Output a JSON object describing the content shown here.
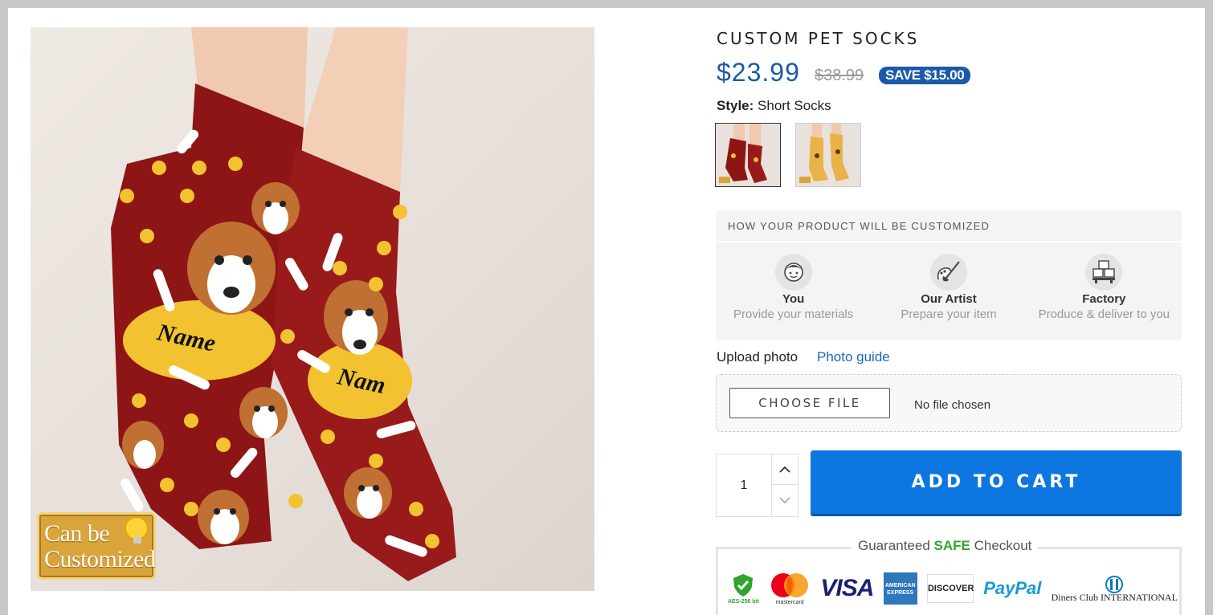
{
  "product": {
    "title": "CUSTOM PET SOCKS",
    "price": "$23.99",
    "old_price": "$38.99",
    "save_badge": "SAVE $15.00",
    "badge_text": "Can be Customized"
  },
  "style": {
    "label": "Style:",
    "value": "Short Socks",
    "swatches": [
      "short-socks-red",
      "long-socks-yellow"
    ]
  },
  "customization": {
    "heading": "HOW YOUR PRODUCT WILL BE CUSTOMIZED",
    "steps": [
      {
        "icon": "user-icon",
        "name": "You",
        "desc": "Provide your materials"
      },
      {
        "icon": "brush-icon",
        "name": "Our Artist",
        "desc": "Prepare your item"
      },
      {
        "icon": "boxes-icon",
        "name": "Factory",
        "desc": "Produce & deliver to you"
      }
    ]
  },
  "upload": {
    "label": "Upload photo",
    "guide_link": "Photo guide",
    "button": "CHOOSE FILE",
    "status": "No file chosen"
  },
  "cart": {
    "quantity": "1",
    "button": "ADD TO CART"
  },
  "checkout": {
    "title_prefix": "Guaranteed ",
    "title_safe": "SAFE",
    "title_suffix": " Checkout",
    "methods": [
      "AES-256 bit",
      "mastercard",
      "VISA",
      "AMERICAN EXPRESS",
      "DISCOVER",
      "PayPal",
      "Diners Club INTERNATIONAL"
    ]
  },
  "colors": {
    "accent": "#1a5aa8",
    "cart_button": "#0d76e0",
    "safe": "#2ea52e",
    "sock_red": "#8e1515",
    "paw_yellow": "#f2c230"
  }
}
